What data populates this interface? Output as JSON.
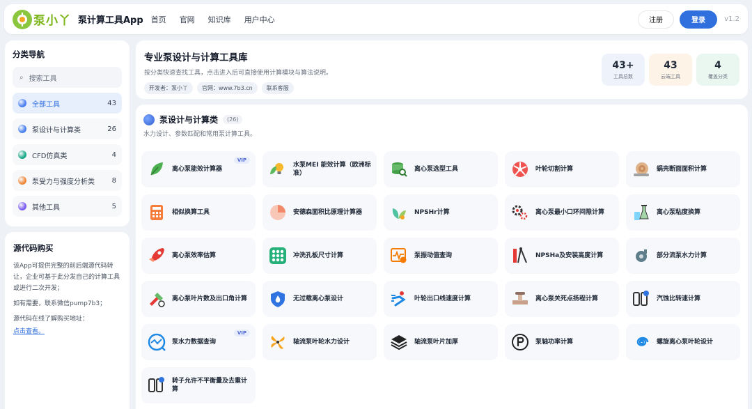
{
  "header": {
    "logo_text": "泵小丫",
    "app_title": "泵计算工具App",
    "nav": [
      "首页",
      "官网",
      "知识库",
      "用户中心"
    ],
    "register_label": "注册",
    "login_label": "登录",
    "version": "v1.2"
  },
  "sidebar": {
    "title": "分类导航",
    "search_placeholder": "搜索工具",
    "categories": [
      {
        "label": "全部工具",
        "count": "43",
        "color": "#4a7ff0",
        "active": true
      },
      {
        "label": "泵设计与计算类",
        "count": "26",
        "color": "#4a7ff0",
        "active": false
      },
      {
        "label": "CFD仿真类",
        "count": "4",
        "color": "#1aa889",
        "active": false
      },
      {
        "label": "泵受力与强度分析类",
        "count": "8",
        "color": "#f0883a",
        "active": false
      },
      {
        "label": "其他工具",
        "count": "5",
        "color": "#7c5cf0",
        "active": false
      }
    ]
  },
  "source": {
    "title": "源代码购买",
    "p1": "该App可提供完整的前后端源代码转让，企业可基于此分发自己的计算工具或进行二次开发；",
    "p2": "如有需要，联系微信pump7b3；",
    "p3": "源代码在线了解购买地址：",
    "link": "点击查看。"
  },
  "banner": {
    "title": "专业泵设计与计算工具库",
    "subtitle": "按分类快速查找工具，点击进入后可直接使用计算模块与算法说明。",
    "tags": [
      "开发者：泵小丫",
      "官网：www.7b3.cn",
      "联系客服"
    ],
    "stats": [
      {
        "value": "43+",
        "label": "工具总数",
        "bg": "#eef2fb"
      },
      {
        "value": "43",
        "label": "云端工具",
        "bg": "#fdf3e6"
      },
      {
        "value": "4",
        "label": "覆盖分类",
        "bg": "#eaf7f0"
      }
    ]
  },
  "section": {
    "title": "泵设计与计算类",
    "count": "(26)",
    "subtitle": "水力设计、参数匹配和常用泵计算工具。"
  },
  "tools": [
    {
      "name": "离心泵能效计算器",
      "icon": "leaf-icon",
      "vip": "VIP"
    },
    {
      "name": "水泵MEI 能效计算（欧洲标准）",
      "icon": "bulb-leaf-icon",
      "vip": ""
    },
    {
      "name": "离心泵选型工具",
      "icon": "database-search-icon",
      "vip": ""
    },
    {
      "name": "叶轮切割计算",
      "icon": "impeller-icon",
      "vip": ""
    },
    {
      "name": "蜗壳断面面积计算",
      "icon": "snail-icon",
      "vip": ""
    },
    {
      "name": "相似换算工具",
      "icon": "calculator-icon",
      "vip": ""
    },
    {
      "name": "安德森面积比原理计算器",
      "icon": "pie-icon",
      "vip": ""
    },
    {
      "name": "NPSHr计算",
      "icon": "plant-gear-icon",
      "vip": ""
    },
    {
      "name": "离心泵最小口环间隙计算",
      "icon": "gears-icon",
      "vip": ""
    },
    {
      "name": "离心泵粘度换算",
      "icon": "lab-icon",
      "vip": ""
    },
    {
      "name": "离心泵效率估算",
      "icon": "rocket-icon",
      "vip": ""
    },
    {
      "name": "冲洗孔板尺寸计算",
      "icon": "dots-grid-icon",
      "vip": ""
    },
    {
      "name": "泵振动值查询",
      "icon": "vibration-icon",
      "vip": ""
    },
    {
      "name": "NPSHa及安装高度计算",
      "icon": "measure-icon",
      "vip": ""
    },
    {
      "name": "部分流泵水力计算",
      "icon": "pump-icon",
      "vip": ""
    },
    {
      "name": "离心泵叶片数及出口角计算",
      "icon": "tools-icon",
      "vip": ""
    },
    {
      "name": "无过载离心泵设计",
      "icon": "shield-fire-icon",
      "vip": ""
    },
    {
      "name": "叶轮出口线速度计算",
      "icon": "runner-icon",
      "vip": ""
    },
    {
      "name": "离心泵关死点扬程计算",
      "icon": "valve-icon",
      "vip": ""
    },
    {
      "name": "汽蚀比转速计算",
      "icon": "panel-dot-icon",
      "vip": ""
    },
    {
      "name": "泵水力数据查询",
      "icon": "chart-search-icon",
      "vip": "VIP"
    },
    {
      "name": "轴流泵叶轮水力设计",
      "icon": "fan-icon",
      "vip": ""
    },
    {
      "name": "轴流泵叶片加厚",
      "icon": "layers-icon",
      "vip": ""
    },
    {
      "name": "泵轴功率计算",
      "icon": "power-p-icon",
      "vip": ""
    },
    {
      "name": "螺旋离心泵叶轮设计",
      "icon": "spiral-icon",
      "vip": ""
    },
    {
      "name": "转子允许不平衡量及去重计算",
      "icon": "panel-dot-icon",
      "vip": ""
    }
  ]
}
